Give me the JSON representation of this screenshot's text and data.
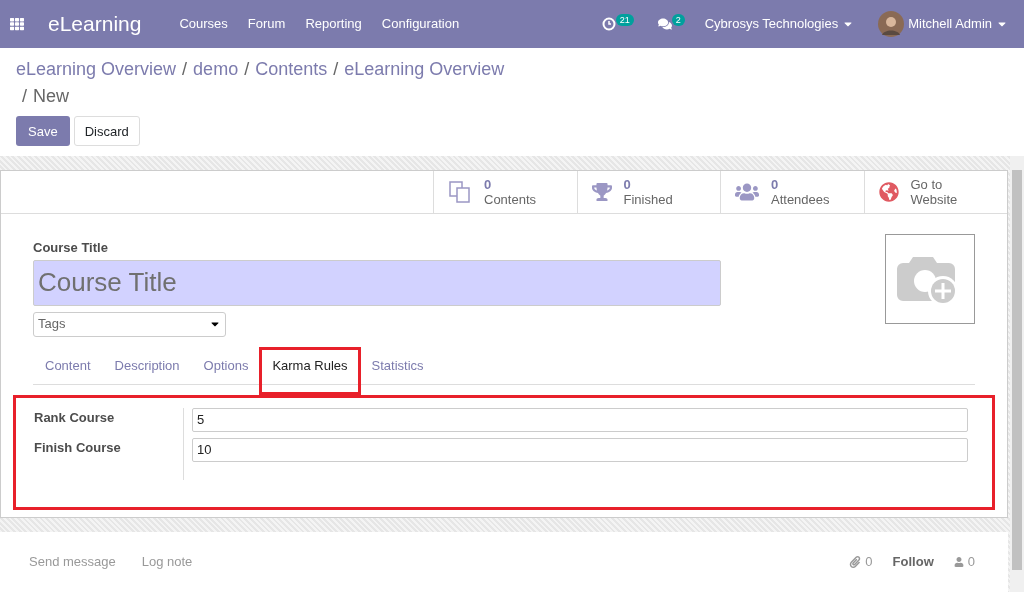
{
  "navbar": {
    "app": "eLearning",
    "menu": [
      "Courses",
      "Forum",
      "Reporting",
      "Configuration"
    ],
    "activity_count": "21",
    "message_count": "2",
    "company": "Cybrosys Technologies",
    "user": "Mitchell Admin"
  },
  "breadcrumb": [
    "eLearning Overview",
    "demo",
    "Contents",
    "eLearning Overview"
  ],
  "breadcrumb_current": "New",
  "breadcrumb_separator": "/",
  "buttons": [
    {
      "label": "Save",
      "kind": "primary"
    },
    {
      "label": "Discard",
      "kind": "secondary"
    }
  ],
  "stats": [
    {
      "kind": "contents",
      "value": "0",
      "label": "Contents"
    },
    {
      "kind": "finished",
      "value": "0",
      "label": "Finished"
    },
    {
      "kind": "attendees",
      "value": "0",
      "label": "Attendees"
    },
    {
      "kind": "website",
      "value": "Go to",
      "label": "Website"
    }
  ],
  "form": {
    "title_label": "Course Title",
    "title_placeholder": "Course Title",
    "tags_placeholder": "Tags"
  },
  "tabs": [
    {
      "label": "Content",
      "selected": false,
      "highlighted": false
    },
    {
      "label": "Description",
      "selected": false,
      "highlighted": false
    },
    {
      "label": "Options",
      "selected": false,
      "highlighted": false
    },
    {
      "label": "Karma Rules",
      "selected": true,
      "highlighted": true
    },
    {
      "label": "Statistics",
      "selected": false,
      "highlighted": false
    }
  ],
  "fields": [
    {
      "label": "Rank Course",
      "value": "5"
    },
    {
      "label": "Finish Course",
      "value": "10"
    }
  ],
  "chatter": {
    "send": "Send message",
    "log": "Log note",
    "attachments": "0",
    "follow": "Follow",
    "followers": "0"
  }
}
